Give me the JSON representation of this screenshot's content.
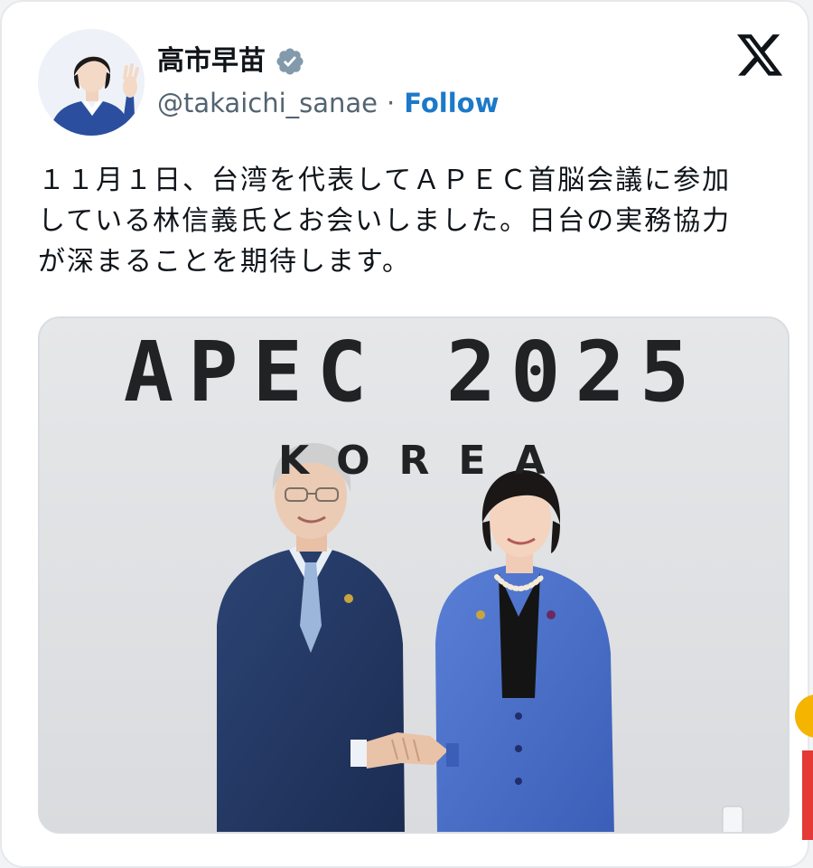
{
  "post": {
    "author": {
      "display_name": "高市早苗",
      "handle": "@takaichi_sanae",
      "verified_icon": "verified-badge-icon",
      "separator": "·",
      "follow_label": "Follow"
    },
    "platform_icon": "x-logo-icon",
    "text": "１１月１日、台湾を代表してＡＰＥＣ首脳会議に参加\nしている林信義氏とお会いしました。日台の実務協力\nが深まることを期待します。",
    "media": {
      "banner_title": "APEC 2025",
      "banner_subtitle": "KOREA"
    }
  },
  "colors": {
    "link": "#1d79c8",
    "verified": "#829aab",
    "text": "#0f1419",
    "muted": "#536471"
  }
}
